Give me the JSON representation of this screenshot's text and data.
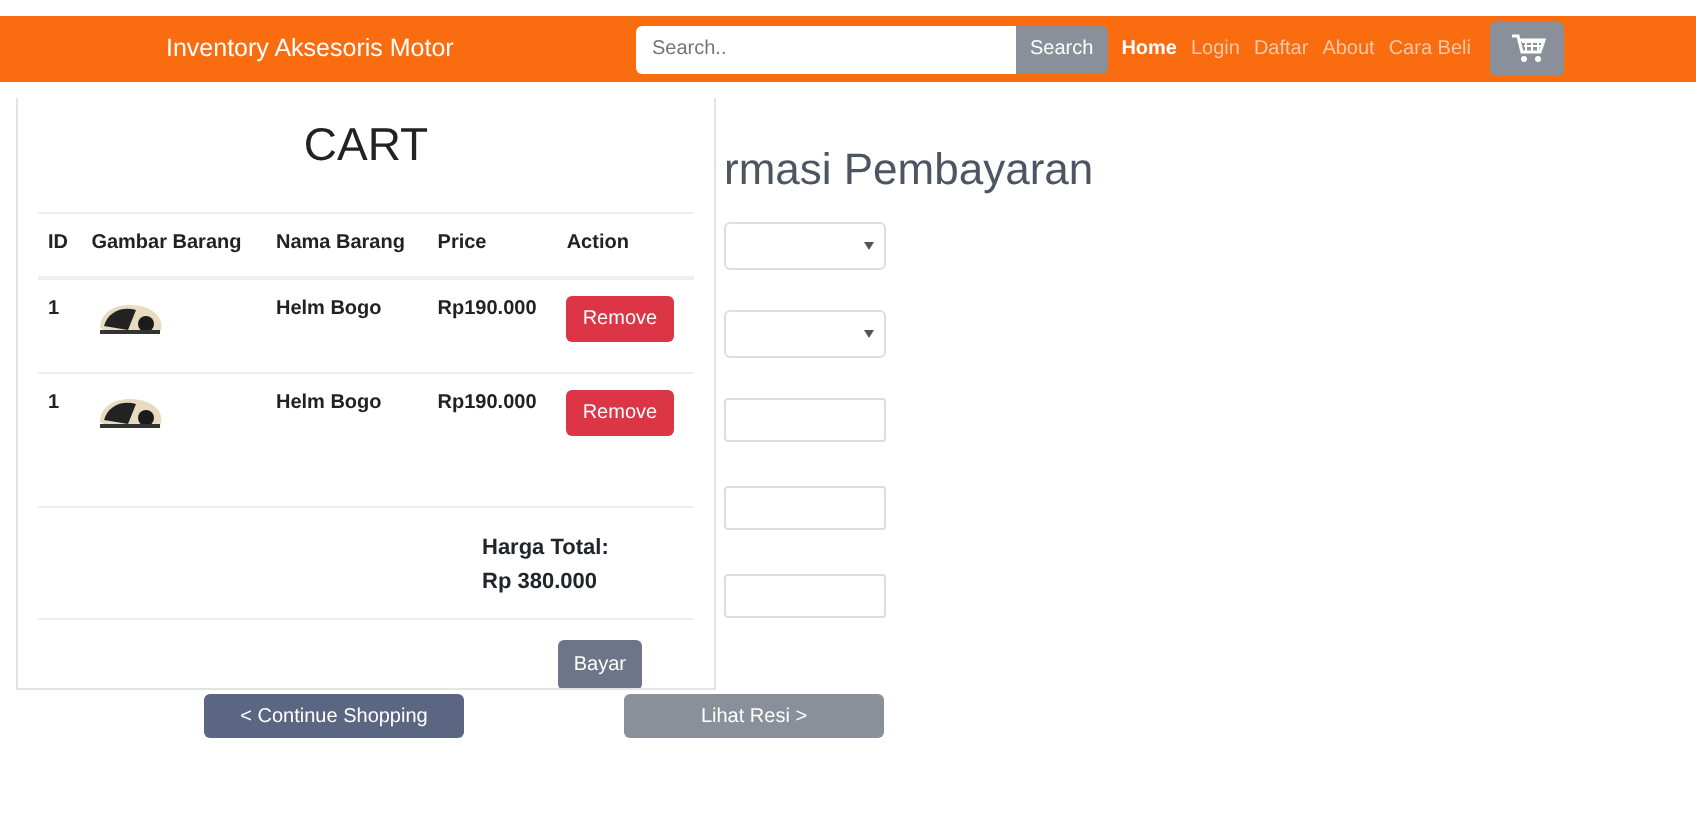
{
  "navbar": {
    "brand": "Inventory Aksesoris Motor",
    "search": {
      "placeholder": "Search.."
    },
    "search_button": "Search",
    "links": [
      {
        "label": "Home",
        "selected": true
      },
      {
        "label": "Login",
        "selected": false
      },
      {
        "label": "Daftar",
        "selected": false
      },
      {
        "label": "About",
        "selected": false
      },
      {
        "label": "Cara Beli",
        "selected": false
      }
    ]
  },
  "page": {
    "heading": "rmasi Pembayaran",
    "fields": [
      {
        "kind": "select"
      },
      {
        "kind": "select"
      },
      {
        "kind": "input"
      },
      {
        "kind": "input"
      },
      {
        "kind": "input"
      }
    ],
    "buttons": [
      {
        "label": "< Continue Shopping",
        "kind": "primary"
      },
      {
        "label": "Lihat Resi >",
        "kind": "secondary"
      }
    ]
  },
  "cart": {
    "title": "CART",
    "columns": [
      "ID",
      "Gambar Barang",
      "Nama Barang",
      "Price",
      "Action"
    ],
    "rows": [
      {
        "id": "1",
        "name": "Helm Bogo",
        "price": "Rp190.000",
        "action": "Remove"
      },
      {
        "id": "1",
        "name": "Helm Bogo",
        "price": "Rp190.000",
        "action": "Remove"
      }
    ],
    "total_label": "Harga Total:",
    "total_value": "Rp 380.000",
    "pay_button": "Bayar"
  }
}
